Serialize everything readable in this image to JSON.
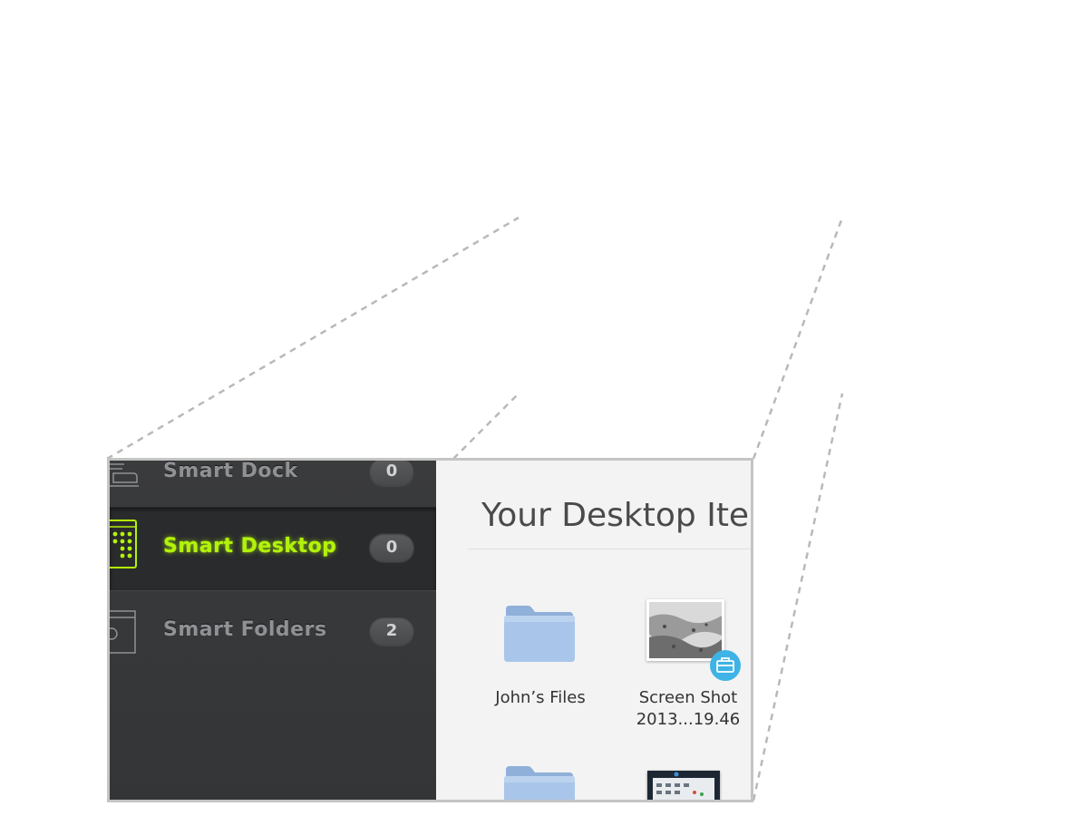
{
  "sidebar": {
    "items": [
      {
        "label": "Smart Dock",
        "count": "0",
        "icon": "dock-icon",
        "selected": false
      },
      {
        "label": "Smart Desktop",
        "count": "0",
        "icon": "desktop-grid-icon",
        "selected": true
      },
      {
        "label": "Smart Folders",
        "count": "2",
        "icon": "gear-folder-icon",
        "selected": false
      }
    ]
  },
  "content": {
    "title": "Your Desktop Ite",
    "files": [
      {
        "name": "John’s Files",
        "icon": "folder-icon"
      },
      {
        "name_line1": "Screen Shot",
        "name_line2": "2013...19.46",
        "icon": "screenshot-thumbnail",
        "badge_icon": "briefcase-icon"
      },
      {
        "name": "",
        "icon": "folder-icon"
      },
      {
        "name": "",
        "icon": "screenshot-thumbnail"
      }
    ]
  },
  "colors": {
    "selected_label": "#b3f20a",
    "sidebar_bg": "#3a3b3d",
    "content_bg": "#f3f3f3",
    "share_badge": "#3eb3e6",
    "folder": "#9dbde3"
  }
}
